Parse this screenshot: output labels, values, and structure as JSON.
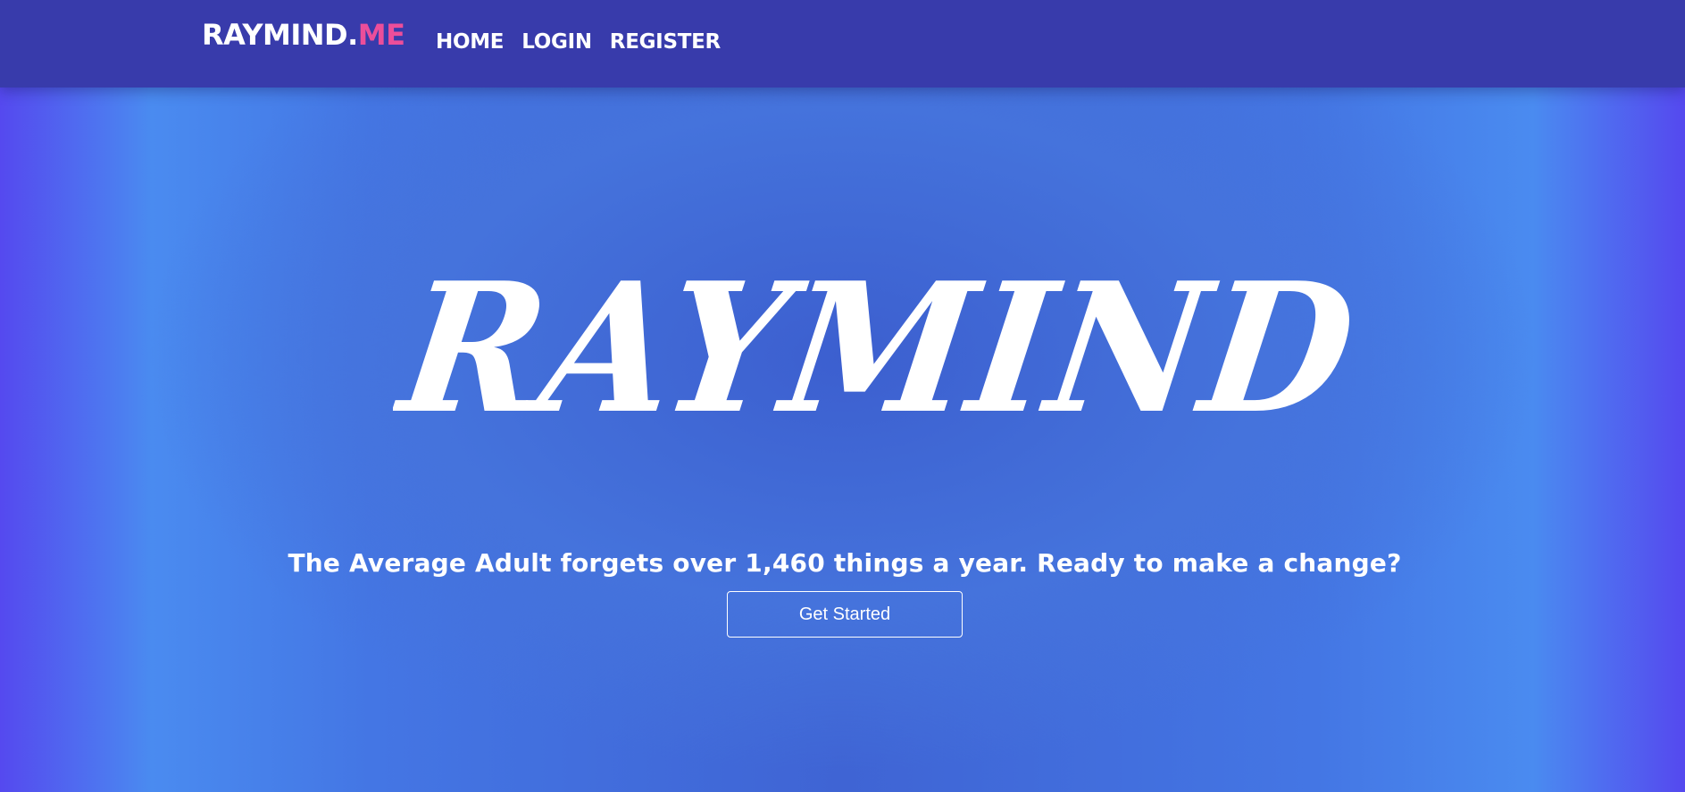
{
  "navbar": {
    "brand_main": "RAYMIND.",
    "brand_accent": "ME",
    "links": [
      {
        "label": "HOME"
      },
      {
        "label": "LOGIN"
      },
      {
        "label": "REGISTER"
      }
    ]
  },
  "hero": {
    "logo_text": "RAYMIND",
    "tagline": "The Average Adult forgets over 1,460 things a year. Ready to make a change?",
    "cta_label": "Get Started"
  },
  "colors": {
    "navbar_bg": "#383bab",
    "brand_accent": "#ec4e9a",
    "hero_center": "#3f64d4",
    "hero_edge": "#5549ef",
    "text": "#ffffff"
  }
}
